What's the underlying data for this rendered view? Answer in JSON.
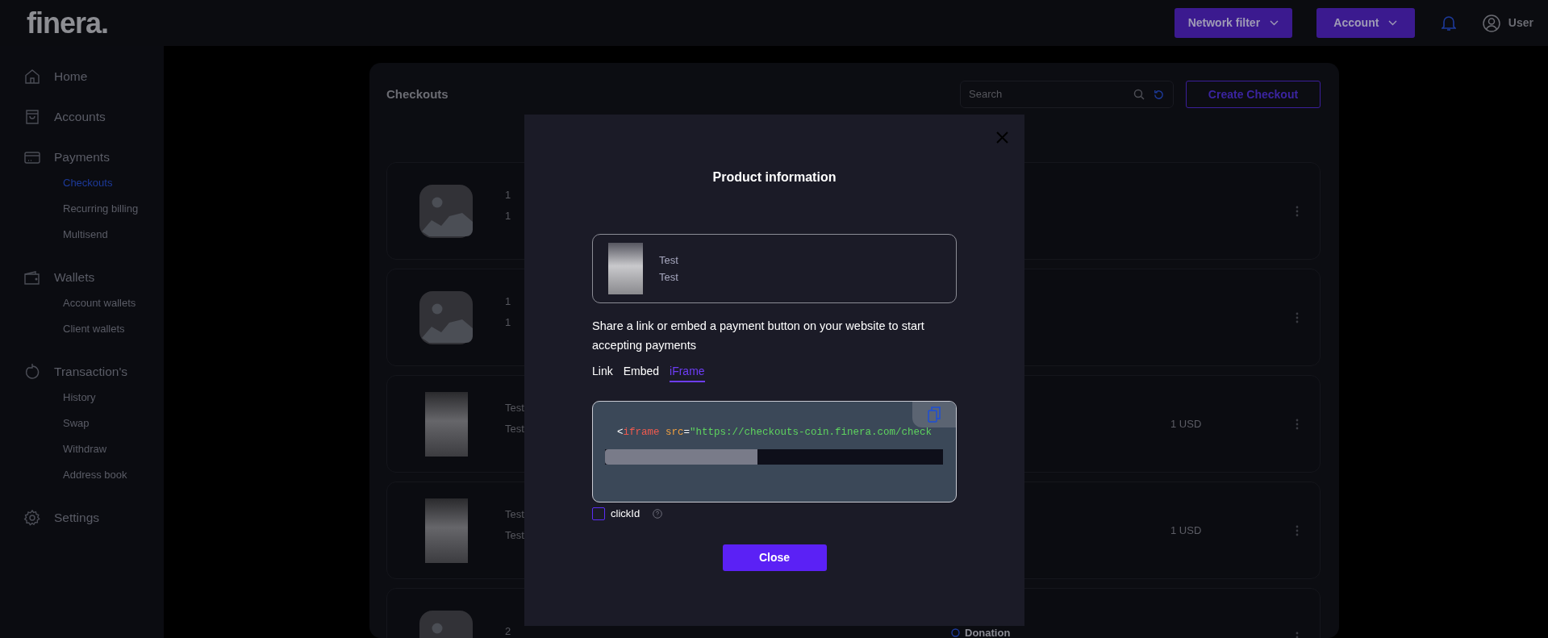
{
  "header": {
    "logo": "finera.",
    "buttons": [
      {
        "label": "Network filter"
      },
      {
        "label": "Account"
      }
    ],
    "user_label": "User"
  },
  "sidebar": {
    "items": [
      {
        "label": "Home",
        "kind": "home",
        "selected": false
      },
      {
        "label": "Accounts",
        "kind": "bag",
        "selected": false
      },
      {
        "label": "Payments",
        "kind": "card",
        "selected": false,
        "children": [
          {
            "label": "Checkouts",
            "selected": true
          },
          {
            "label": "Recurring billing",
            "selected": false
          },
          {
            "label": "Multisend",
            "selected": false
          }
        ]
      },
      {
        "label": "Wallets",
        "kind": "wallet",
        "selected": false,
        "children": [
          {
            "label": "Account wallets",
            "selected": false
          },
          {
            "label": "Client wallets",
            "selected": false
          }
        ]
      },
      {
        "label": "Transaction's",
        "kind": "history",
        "selected": false,
        "children": [
          {
            "label": "History",
            "selected": false
          },
          {
            "label": "Swap",
            "selected": false
          },
          {
            "label": "Withdraw",
            "selected": false
          },
          {
            "label": "Address book",
            "selected": false
          }
        ]
      },
      {
        "label": "Settings",
        "kind": "gear",
        "selected": false
      }
    ]
  },
  "page": {
    "title": "Checkouts",
    "search": {
      "placeholder": "Search"
    },
    "create_button": "Create Checkout",
    "rows": [
      {
        "kind": "placeholder",
        "title": "1",
        "subtitle": "1"
      },
      {
        "kind": "placeholder",
        "title": "1",
        "subtitle": "1"
      },
      {
        "kind": "photo",
        "title": "Test",
        "subtitle": "Test",
        "price": "1 USD"
      },
      {
        "kind": "photo",
        "title": "Test",
        "subtitle": "Test",
        "price": "1 USD"
      },
      {
        "kind": "placeholder",
        "title": "2",
        "tag": "Donation"
      }
    ]
  },
  "modal": {
    "title": "Product information",
    "product": {
      "title": "Test",
      "subtitle": "Test"
    },
    "description": "Share a link or embed a payment button on your website to start accepting payments",
    "tabs": [
      {
        "label": "Link",
        "selected": false
      },
      {
        "label": "Embed",
        "selected": false
      },
      {
        "label": "iFrame",
        "selected": true
      }
    ],
    "code": [
      {
        "kind": "punct",
        "text": "<"
      },
      {
        "kind": "tag",
        "text": "iframe"
      },
      {
        "kind": "attr",
        "text": "src"
      },
      {
        "kind": "punct",
        "text": "="
      },
      {
        "kind": "string",
        "text": "\"https://checkouts-coin.finera.com/check"
      }
    ],
    "clickid": {
      "label": "clickId",
      "checked": false
    },
    "close_button": "Close"
  }
}
